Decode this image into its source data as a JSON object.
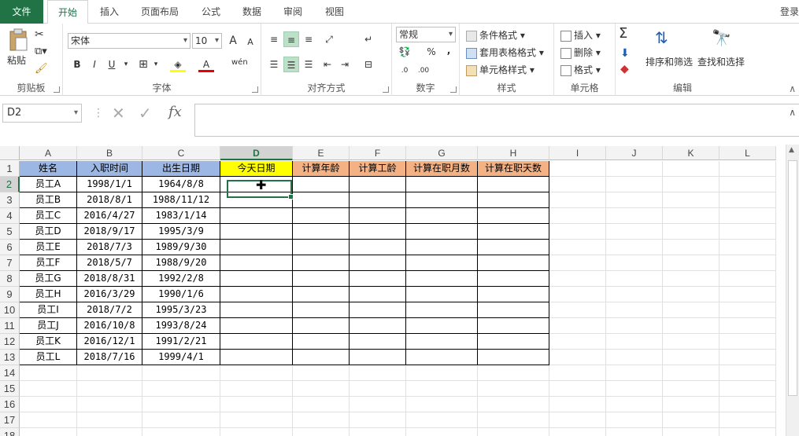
{
  "tabs": {
    "file": "文件",
    "home": "开始",
    "insert": "插入",
    "layout": "页面布局",
    "formulas": "公式",
    "data": "数据",
    "review": "审阅",
    "view": "视图",
    "login": "登录"
  },
  "ribbon": {
    "clipboard": {
      "paste": "粘贴",
      "label": "剪贴板"
    },
    "font": {
      "name": "宋体",
      "size": "10",
      "bold": "B",
      "italic": "I",
      "underline": "U",
      "label": "字体",
      "wen": "wén",
      "grow": "A",
      "shrink": "A"
    },
    "align": {
      "label": "对齐方式"
    },
    "number": {
      "format": "常规",
      "percent": "%",
      "comma": ",",
      "label": "数字"
    },
    "styles": {
      "conditional": "条件格式",
      "table": "套用表格格式",
      "cell": "单元格样式",
      "label": "样式"
    },
    "cells": {
      "insert": "插入",
      "delete": "删除",
      "format": "格式",
      "label": "单元格"
    },
    "editing": {
      "sort": "排序和筛选",
      "find": "查找和选择",
      "label": "编辑",
      "sigma": "Σ"
    }
  },
  "formula_bar": {
    "name_box": "D2",
    "fx": "fx",
    "value": ""
  },
  "colors": {
    "accent": "#217346",
    "header_blue": "#9cb7e3",
    "header_yellow": "#ffff00",
    "header_orange": "#f4b183"
  },
  "columns": [
    "A",
    "B",
    "C",
    "D",
    "E",
    "F",
    "G",
    "H",
    "I",
    "J",
    "K",
    "L"
  ],
  "rows": [
    "1",
    "2",
    "3",
    "4",
    "5",
    "6",
    "7",
    "8",
    "9",
    "10",
    "11",
    "12",
    "13",
    "14",
    "15",
    "16",
    "17",
    "18"
  ],
  "headers": [
    "姓名",
    "入职时间",
    "出生日期",
    "今天日期",
    "计算年龄",
    "计算工龄",
    "计算在职月数",
    "计算在职天数"
  ],
  "table": [
    [
      "员工A",
      "1998/1/1",
      "1964/8/8"
    ],
    [
      "员工B",
      "2018/8/1",
      "1988/11/12"
    ],
    [
      "员工C",
      "2016/4/27",
      "1983/1/14"
    ],
    [
      "员工D",
      "2018/9/17",
      "1995/3/9"
    ],
    [
      "员工E",
      "2018/7/3",
      "1989/9/30"
    ],
    [
      "员工F",
      "2018/5/7",
      "1988/9/20"
    ],
    [
      "员工G",
      "2018/8/31",
      "1992/2/8"
    ],
    [
      "员工H",
      "2016/3/29",
      "1990/1/6"
    ],
    [
      "员工I",
      "2018/7/2",
      "1995/3/23"
    ],
    [
      "员工J",
      "2016/10/8",
      "1993/8/24"
    ],
    [
      "员工K",
      "2016/12/1",
      "1991/2/21"
    ],
    [
      "员工L",
      "2018/7/16",
      "1999/4/1"
    ]
  ]
}
